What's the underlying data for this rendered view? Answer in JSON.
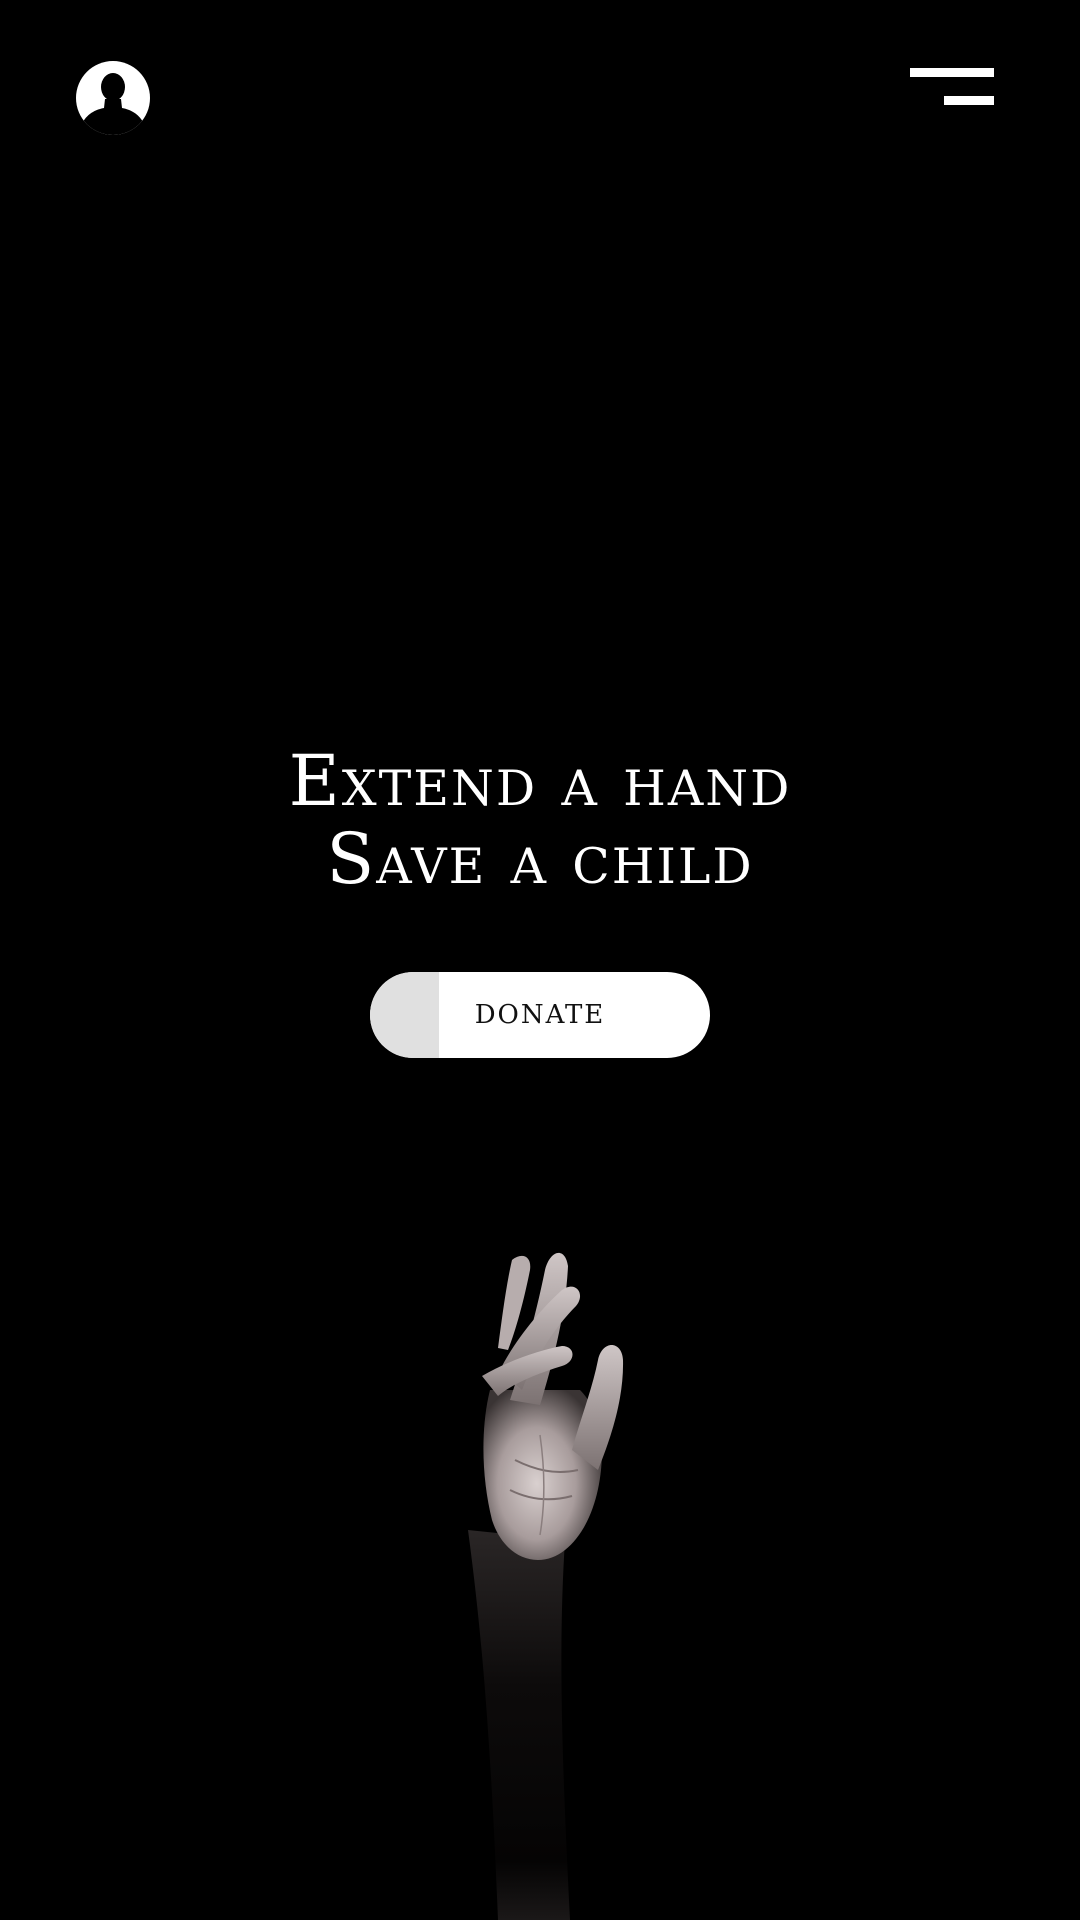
{
  "header": {
    "avatar_icon": "user-avatar-icon",
    "menu_icon": "hamburger-menu-icon"
  },
  "hero": {
    "line1": "Extend a hand",
    "line2": "Save a child"
  },
  "cta": {
    "donate_label": "DONATE"
  },
  "image": {
    "subject": "reaching-hand-icon"
  },
  "colors": {
    "background": "#000000",
    "text": "#ffffff",
    "button_bg": "#ffffff",
    "button_accent": "#e0e0e0",
    "button_text": "#111111"
  }
}
